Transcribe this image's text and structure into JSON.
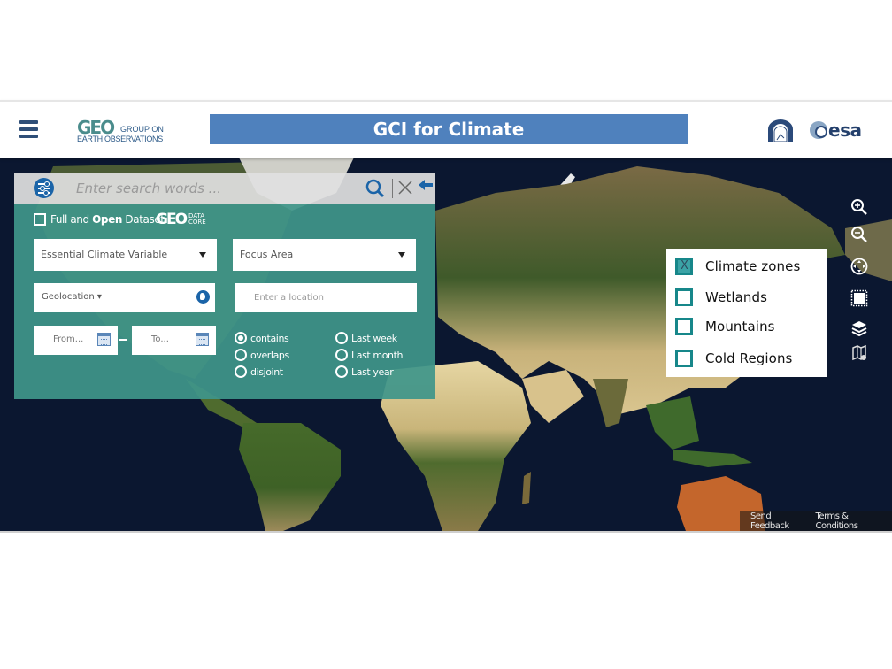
{
  "header": {
    "menu_icon": "hamburger-icon",
    "logo_mark": "GEO",
    "logo_line1": "GROUP ON",
    "logo_line2": "EARTH OBSERVATIONS",
    "title": "GCI for Climate",
    "partner_logo_1": "cnr-logo",
    "partner_logo_2": "esa"
  },
  "search": {
    "filter_icon": "sliders-icon",
    "placeholder": "Enter search words ...",
    "value": "",
    "search_icon": "search-icon",
    "clear_icon": "close-icon",
    "back_icon": "arrow-left-icon",
    "full_open_label_pre": "Full and ",
    "full_open_label_bold": "Open",
    "full_open_label_post": " Dataset",
    "full_open_checked": false,
    "geo_dc_mark": "GEO",
    "geo_dc_line1": "DATA",
    "geo_dc_line2": "CORE",
    "ecv_select": "Essential  Climate  Variable",
    "focus_select": "Focus Area",
    "geolocation_label": "Geolocation ▾",
    "location_placeholder": "Enter a location",
    "date_from": "From...",
    "date_to": "To...",
    "spatial_options": [
      {
        "label": "contains",
        "selected": true
      },
      {
        "label": "overlaps",
        "selected": false
      },
      {
        "label": "disjoint",
        "selected": false
      }
    ],
    "time_options": [
      {
        "label": "Last week",
        "selected": false
      },
      {
        "label": "Last month",
        "selected": false
      },
      {
        "label": "Last year",
        "selected": false
      }
    ]
  },
  "map_tools": [
    "zoom-in-icon",
    "zoom-out-icon",
    "pan-icon",
    "select-area-icon",
    "layers-icon",
    "basemap-icon"
  ],
  "legend": {
    "items": [
      {
        "label": "Climate zones",
        "checked": true,
        "mark": "X"
      },
      {
        "label": "Wetlands",
        "checked": false,
        "mark": ""
      },
      {
        "label": "Mountains",
        "checked": false,
        "mark": ""
      },
      {
        "label": "Cold Regions",
        "checked": false,
        "mark": ""
      }
    ]
  },
  "footer": {
    "send_feedback": "Send Feedback",
    "terms": "Terms & Conditions"
  },
  "colors": {
    "title_bar": "#4f81bd",
    "panel_teal": "#3f968a",
    "accent_blue": "#1b64a8",
    "legend_checkbox": "#17878a",
    "ocean": "#0b1730"
  }
}
